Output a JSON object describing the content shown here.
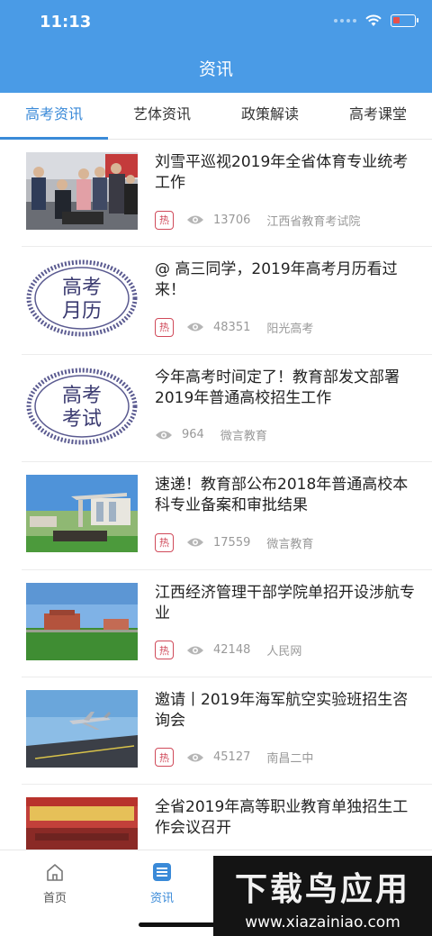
{
  "status_bar": {
    "time": "11:13"
  },
  "header": {
    "title": "资讯"
  },
  "tabs": [
    {
      "label": "高考资讯",
      "active": true
    },
    {
      "label": "艺体资讯",
      "active": false
    },
    {
      "label": "政策解读",
      "active": false
    },
    {
      "label": "高考课堂",
      "active": false
    }
  ],
  "articles": [
    {
      "title": "刘雪平巡视2019年全省体育专业统考工作",
      "hot_badge": "热",
      "views": "13706",
      "source": "江西省教育考试院",
      "thumb": "people-photo"
    },
    {
      "title": "@ 高三同学，2019年高考月历看过来！",
      "hot_badge": "热",
      "views": "48351",
      "source": "阳光高考",
      "thumb": "stamp",
      "thumb_text": [
        "高考",
        "月历"
      ]
    },
    {
      "title": "今年高考时间定了！教育部发文部署2019年普通高校招生工作",
      "hot_badge": "",
      "views": "964",
      "source": "微言教育",
      "thumb": "stamp",
      "thumb_text": [
        "高考",
        "考试"
      ]
    },
    {
      "title": "速递！教育部公布2018年普通高校本科专业备案和审批结果",
      "hot_badge": "热",
      "views": "17559",
      "source": "微言教育",
      "thumb": "campus-gate"
    },
    {
      "title": "江西经济管理干部学院单招开设涉航专业",
      "hot_badge": "热",
      "views": "42148",
      "source": "人民网",
      "thumb": "campus-buildings"
    },
    {
      "title": "邀请丨2019年海军航空实验班招生咨询会",
      "hot_badge": "热",
      "views": "45127",
      "source": "南昌二中",
      "thumb": "jet-carrier"
    },
    {
      "title": "全省2019年高等职业教育单独招生工作会议召开",
      "hot_badge": "",
      "views": "",
      "source": "",
      "thumb": "meeting-hall"
    }
  ],
  "tabbar": {
    "items": [
      {
        "label": "首页",
        "icon": "home-icon",
        "active": false
      },
      {
        "label": "资讯",
        "icon": "news-icon",
        "active": true
      }
    ]
  },
  "watermark": {
    "main": "下载鸟应用",
    "url": "www.xiazainiao.com"
  },
  "colors": {
    "header_blue": "#4a9be6",
    "active_tab": "#3a8ad8",
    "hot_red": "#d04a5a"
  }
}
